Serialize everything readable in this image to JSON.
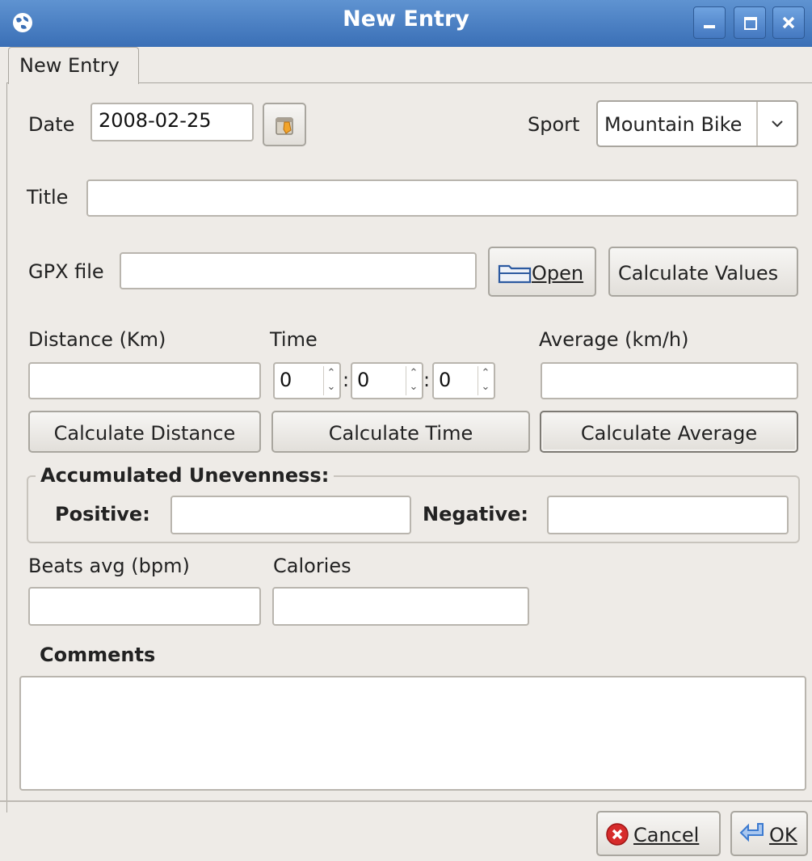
{
  "window": {
    "title": "New Entry",
    "icons": [
      "globe-icon",
      "minimize-icon",
      "maximize-icon",
      "close-icon"
    ]
  },
  "tab": {
    "label": "New Entry"
  },
  "form": {
    "date_label": "Date",
    "date_value": "2008-02-25",
    "sport_label": "Sport",
    "sport_value": "Mountain Bike",
    "title_label": "Title",
    "title_value": "",
    "gpx_label": "GPX file",
    "gpx_value": "",
    "open_label": "Open",
    "calculate_values_label": "Calculate Values",
    "distance_label": "Distance (Km)",
    "distance_value": "",
    "time_label": "Time",
    "time_hours": "0",
    "time_minutes": "0",
    "time_seconds": "0",
    "time_sep": ":",
    "average_label": "Average (km/h)",
    "average_value": "",
    "calc_distance_label": "Calculate Distance",
    "calc_time_label": "Calculate Time",
    "calc_average_label": "Calculate Average",
    "unevenness_label": "Accumulated Unevenness:",
    "positive_label": "Positive:",
    "positive_value": "",
    "negative_label": "Negative:",
    "negative_value": "",
    "beats_label": "Beats avg (bpm)",
    "beats_value": "",
    "calories_label": "Calories",
    "calories_value": "",
    "comments_label": "Comments",
    "comments_value": ""
  },
  "footer": {
    "cancel_label": "Cancel",
    "ok_label": "OK"
  },
  "colors": {
    "titlebar": "#4a80c6",
    "background": "#eeebe7",
    "cancel_icon": "#d62b2b",
    "ok_icon": "#3d7bd0"
  }
}
